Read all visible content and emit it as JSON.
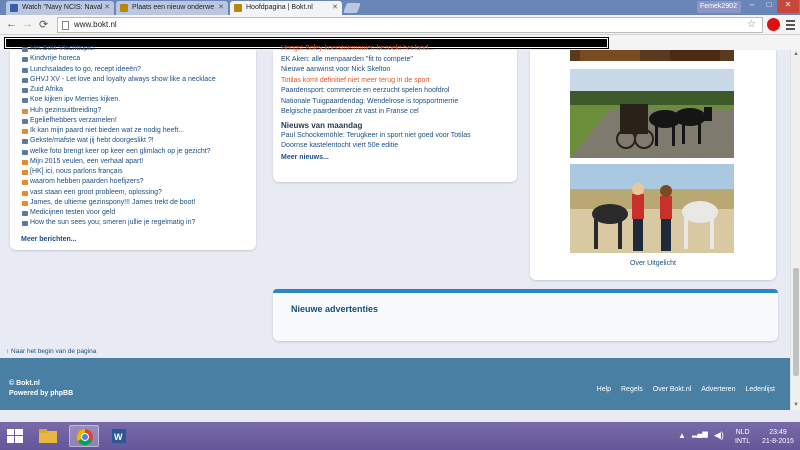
{
  "browser": {
    "tabs": [
      {
        "label": "Watch \"Navy NCIS: Naval",
        "active": false
      },
      {
        "label": "Plaats een nieuw onderwe",
        "active": false
      },
      {
        "label": "Hoofdpagina | Bokt.nl",
        "active": true
      }
    ],
    "user": "Femek2902",
    "url": "www.bokt.nl",
    "window_controls": [
      "–",
      "□",
      "✕"
    ]
  },
  "left_topics": {
    "items": [
      {
        "label": "Het Bokt Vlechttopic!",
        "color": "grey"
      },
      {
        "label": "Kindvrije horeca",
        "color": "grey"
      },
      {
        "label": "Lunchsalades to go, recept ideeën?",
        "color": "grey"
      },
      {
        "label": "GHVJ XV - Let love and loyalty always show like a necklace",
        "color": "grey"
      },
      {
        "label": "Zuid Afrika",
        "color": "grey"
      },
      {
        "label": "Koe kijken ipv Merries kijken.",
        "color": "grey"
      },
      {
        "label": "Huh gezinsuitbreiding?",
        "color": "orange"
      },
      {
        "label": "Egeliefhebbers verzamelen!",
        "color": "grey"
      },
      {
        "label": "Ik kan mijn paard niet bieden wat ze nodig heeft...",
        "color": "orange"
      },
      {
        "label": "Gekste/mafste wat jij hebt doorgeslikt ?!",
        "color": "grey"
      },
      {
        "label": "welke foto brengt keer op keer een glimlach op je gezicht?",
        "color": "grey"
      },
      {
        "label": "Mijn 2015 veulen, een verhaal apart!",
        "color": "orange"
      },
      {
        "label": "[HK] ici, nous parlons français",
        "color": "orange"
      },
      {
        "label": "waarom hebben paarden hoefijzers?",
        "color": "orange"
      },
      {
        "label": "vast staan een groot probleem, oplossing?",
        "color": "orange"
      },
      {
        "label": "James, de ultieme gezinspony!!! James trekt de boot!",
        "color": "orange"
      },
      {
        "label": "Medicijnen testen voor geld",
        "color": "grey"
      },
      {
        "label": "How the sun sees you; smeren jullie je regelmatig in?",
        "color": "grey"
      }
    ],
    "more": "Meer berichten..."
  },
  "news": {
    "items": [
      {
        "label": "Hengst Boley koerstoernooien bezoekt het land...",
        "hl": true
      },
      {
        "label": "EK Aken: alle menpaarden \"fit to compete\"",
        "hl": false
      },
      {
        "label": "Nieuwe aanwinst voor Nick Skelton",
        "hl": false
      },
      {
        "label": "Totilas komt definitief niet meer terug in de sport",
        "hl": true
      },
      {
        "label": "Paardensport: commercie en eerzucht spelen hoofdrol",
        "hl": false
      },
      {
        "label": "Nationale Tuigpaardendag: Wendelrose is topsportmerrie",
        "hl": false
      },
      {
        "label": "Belgische paardenboer zit vast in Franse cel",
        "hl": false
      }
    ],
    "monday_heading": "Nieuws van maandag",
    "monday_items": [
      {
        "label": "Paul Schockemöhle: Terugkeer in sport niet goed voor Totilas",
        "hl": false
      },
      {
        "label": "Doornse kastelentocht viert 50e editie",
        "hl": false
      }
    ],
    "more": "Meer nieuws..."
  },
  "highlight": {
    "caption": "Over Uitgelicht"
  },
  "ads": {
    "title": "Nieuwe advertenties"
  },
  "back_to_top": "↑ Naar het begin van de pagina",
  "footer": {
    "copyright": "© Bokt.nl",
    "powered": "Powered by phpBB",
    "links": [
      "Help",
      "Regels",
      "Over Bokt.nl",
      "Adverteren",
      "Ledenlijst"
    ]
  },
  "taskbar": {
    "lang": "NLD",
    "layout": "INTL",
    "time": "23:49",
    "date": "21-8-2015"
  },
  "colors": {
    "link": "#1a4f85",
    "highlight_news": "#e05a28",
    "footer_bg": "#4a7fa4",
    "accent": "#2a87c6"
  }
}
